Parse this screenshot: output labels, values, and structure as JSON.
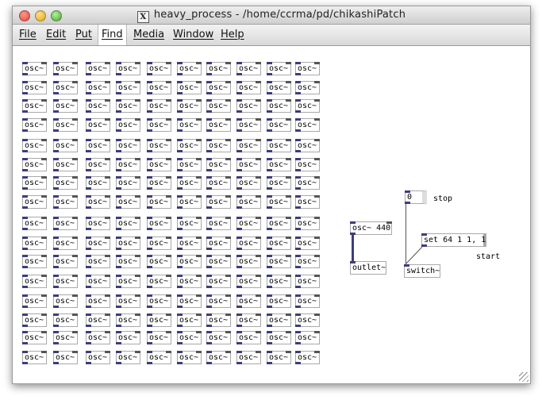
{
  "window": {
    "title": "heavy_process  - /home/ccrma/pd/chikashiPatch",
    "icon": "x11-icon"
  },
  "menubar": {
    "items": [
      "File",
      "Edit",
      "Put",
      "Find",
      "Media",
      "Window",
      "Help"
    ],
    "active_item": "Find"
  },
  "patch": {
    "osc_object_label": "osc~",
    "osc_grid": {
      "columns": 10,
      "rows": 16
    },
    "osc440_label": "osc~ 440",
    "outlet_label": "outlet~",
    "number_box_value": "0",
    "stop_label": "stop",
    "set_message": "set 64 1 1, 1",
    "start_label": "start",
    "switch_label": "switch~"
  },
  "colors": {
    "inlet_outlet": "#3d3d7a",
    "object_border": "#a9a9a9",
    "canvas_bg": "#ffffff"
  }
}
